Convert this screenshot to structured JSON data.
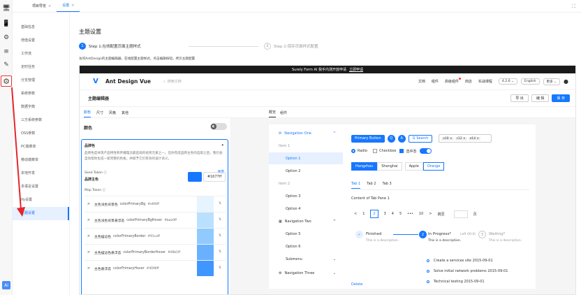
{
  "tabs": [
    {
      "label": "项目导览",
      "closable": "×"
    },
    {
      "label": "设置",
      "closable": "×"
    }
  ],
  "expand_icon": "⛶",
  "left_nav": [
    "基础信息",
    "增值设置",
    "工作流",
    "定时任务",
    "分支管理",
    "系统参数",
    "数据字典",
    "三方系统参数",
    "OSS参数",
    "PC端菜单",
    "移动端菜单",
    "本地开发",
    "多语言设置",
    "ify设置",
    "主题设置"
  ],
  "page_title": "主题设置",
  "steps": [
    {
      "num": "1",
      "label": "Step 1:在线配置页面主题样式"
    },
    {
      "num": "2",
      "label": "Step 2:保存页面样式配置"
    }
  ],
  "intro": "访问AntDesign的主题编辑器，在线配置主题样式，点击编辑按钮，拷贝主题配置",
  "banner": {
    "text": "Surely Form AI 我手内测开放申请",
    "link": "立即申请"
  },
  "brand": "Ant Design Vue",
  "search_placeholder": "搜索文档",
  "nav_links": [
    "文档",
    "组件",
    "高级组件",
    "商店",
    "实战课程"
  ],
  "version": "4.2.6 ⌄",
  "lang": "English",
  "more": "更多 ⌄",
  "editor_title": "主题编辑器",
  "editor_buttons": [
    "导 出",
    "编 辑",
    "保 存"
  ],
  "left_tabs": [
    "颜色",
    "尺寸",
    "风格",
    "其他"
  ],
  "section_label": "颜色",
  "card": {
    "title": "品牌色",
    "desc": "品牌色是体现产品特性和传播理念最直观的视觉元素之一。在你完成品牌主色的选取之后，我们会自动帮你生成一套完整的色板，并赋予它们有效的设计语义。",
    "seed_label": "Seed Token ⓘ",
    "reset": "重置",
    "seed_name": "品牌主色",
    "hex": "#1677ff",
    "map_label": "Map Token ⓘ",
    "rows": [
      {
        "name": "主色浅色背景色",
        "token": "colorPrimaryBg",
        "value": "#e6f4ff",
        "color": "#e6f4ff"
      },
      {
        "name": "主色浅色背景悬浮态",
        "token": "colorPrimaryBgHover",
        "value": "#bae0ff",
        "color": "#bae0ff"
      },
      {
        "name": "主色描边色",
        "token": "colorPrimaryBorder",
        "value": "#91caff",
        "color": "#91caff"
      },
      {
        "name": "主色描边色悬浮态",
        "token": "colorPrimaryBorderHover",
        "value": "#69b1ff",
        "color": "#69b1ff"
      },
      {
        "name": "主色悬浮态",
        "token": "colorPrimaryHover",
        "value": "#4096ff",
        "color": "#4096ff"
      }
    ]
  },
  "preview_tabs": [
    "概览",
    "组件"
  ],
  "menu": {
    "nav1": "Navigation One",
    "group1": "Item 1",
    "opt1": "Option 1",
    "opt2": "Option 2",
    "group2": "Item 2",
    "opt3": "Option 3",
    "opt4": "Option 4",
    "nav2": "Navigation Two",
    "opt5": "Option 5",
    "opt6": "Option 6",
    "submenu": "Submenu",
    "nav3": "Navigation Three"
  },
  "buttons": {
    "primary": "Primary Button",
    "q": "Q",
    "a": "A",
    "search": "Q  Search"
  },
  "tags": [
    "x10 ×",
    "c12 ×",
    "e14 ×"
  ],
  "radio": "Radio",
  "checkbox": "Checkbox",
  "checked": "选中态",
  "segmented": [
    "Hangzhou",
    "Shanghai",
    "Apple",
    "Orange"
  ],
  "inner_tabs": [
    "Tab 1",
    "Tab 2",
    "Tab 3"
  ],
  "tab_content": "Content of Tab Pane 1",
  "pager": {
    "prev": "<",
    "pages": [
      "1",
      "2",
      "3",
      "4",
      "5",
      "•••",
      "10"
    ],
    "next": ">",
    "jump": "跳至",
    "page": "页"
  },
  "step_items": [
    {
      "num": "✓",
      "title": "Finished",
      "desc": "This is a description."
    },
    {
      "num": "2",
      "title": "In Progress*",
      "extra": "Left 00:0(",
      "desc": "This is a description."
    },
    {
      "num": "3",
      "title": "Waiting*",
      "desc": "This is a description."
    }
  ],
  "timeline": [
    "Create a services site 2015-09-01",
    "Solve initial network problems 2015-09-01",
    "Technical testing 2015-09-01"
  ],
  "delete": "Delete",
  "ai_label": "Ai"
}
